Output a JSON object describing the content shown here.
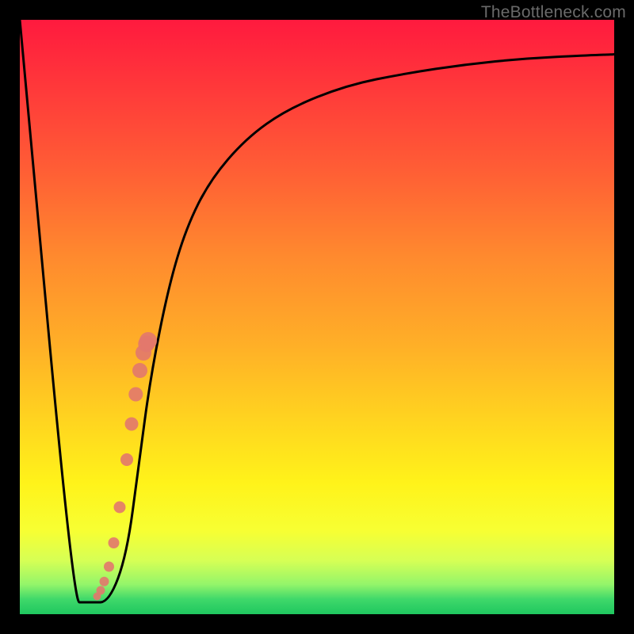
{
  "watermark": "TheBottleneck.com",
  "chart_data": {
    "type": "line",
    "title": "",
    "xlabel": "",
    "ylabel": "",
    "xlim": [
      0,
      100
    ],
    "ylim": [
      0,
      100
    ],
    "background_gradient": {
      "direction": "vertical",
      "stops": [
        {
          "pos": 0,
          "color": "#ff1a3e"
        },
        {
          "pos": 25,
          "color": "#ff5d35"
        },
        {
          "pos": 55,
          "color": "#ffb027"
        },
        {
          "pos": 78,
          "color": "#fff31a"
        },
        {
          "pos": 95,
          "color": "#93f56a"
        },
        {
          "pos": 100,
          "color": "#1fc75f"
        }
      ]
    },
    "series": [
      {
        "name": "bottleneck-curve",
        "color": "#000000",
        "x": [
          0,
          9,
          11,
          12,
          15,
          18,
          20,
          22,
          25,
          28,
          32,
          38,
          45,
          55,
          65,
          75,
          85,
          95,
          100
        ],
        "y": [
          100,
          2,
          2,
          2,
          2,
          10,
          25,
          40,
          55,
          65,
          73,
          80,
          85,
          89,
          91,
          92.5,
          93.5,
          94,
          94.2
        ]
      }
    ],
    "points": {
      "name": "highlight-dots",
      "color": "#e2786d",
      "x": [
        13.0,
        13.6,
        14.2,
        15.0,
        15.8,
        16.8,
        18.0,
        18.8,
        19.5,
        20.2,
        20.8,
        21.3,
        21.6
      ],
      "y": [
        3.0,
        4.0,
        5.5,
        8.0,
        12.0,
        18.0,
        26.0,
        32.0,
        37.0,
        41.0,
        44.0,
        45.5,
        46.0
      ]
    }
  }
}
